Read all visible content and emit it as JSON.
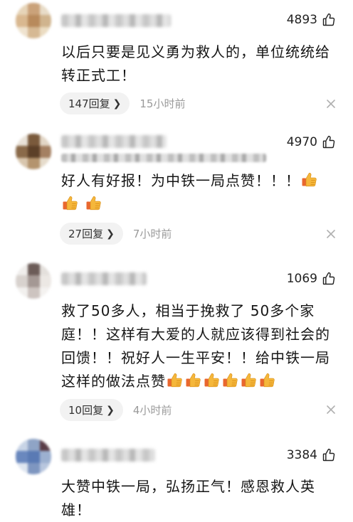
{
  "comments": [
    {
      "likes": "4893",
      "text": "以后只要是见义勇为救人的，单位统统给转正式工！",
      "text_line1": "以后只要是见义勇为救人的，单位统统给",
      "text_line2": "转正式工！",
      "replies": "147回复",
      "time": "15小时前"
    },
    {
      "likes": "4970",
      "text_line1": "好人有好报！为中铁一局点赞！！！",
      "replies": "27回复",
      "time": "7小时前"
    },
    {
      "likes": "1069",
      "text_line1": "救了50多人，相当于挽救了 50多个家",
      "text_line2": "庭！！这样有大爱的人就应该得到社会的",
      "text_line3": "回馈！！祝好人一生平安！！给中铁一局",
      "text_line4": "这样的做法点赞",
      "replies": "10回复",
      "time": "4小时前"
    },
    {
      "likes": "3384",
      "text_line1": "大赞中铁一局，弘扬正气！感恩救人英",
      "text_line2": "雄！"
    }
  ],
  "icons": {
    "like": "thumbs-up-outline-icon",
    "emoji": "thumbs-up-emoji-icon",
    "dismiss": "close-icon",
    "chevron": "chevron-right-icon"
  },
  "colors": {
    "emoji_yellow": "#f5b73b",
    "cuff_orange": "#e9672f",
    "time_gray": "#9a9a9a",
    "pill_bg": "#f2f2f2"
  }
}
